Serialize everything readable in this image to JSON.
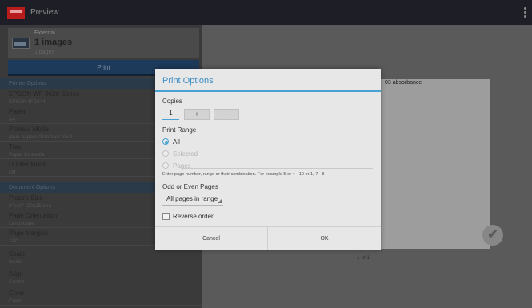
{
  "app": {
    "title": "Preview"
  },
  "source": {
    "label": "External",
    "count": "1 images",
    "pages": "1 pages"
  },
  "print_button": "Print",
  "printer_section": "Printer Options",
  "printer_settings": [
    {
      "label": "EPSON WF-3620 Series",
      "value": "EPSON4FD344"
    },
    {
      "label": "Paper",
      "value": "A4"
    },
    {
      "label": "Printout Mode",
      "value": "plain papers Standard Vivid"
    },
    {
      "label": "Tray",
      "value": "Paper Cassette"
    },
    {
      "label": "Duplex Mode",
      "value": "Off"
    }
  ],
  "document_section": "Document Options",
  "document_settings": [
    {
      "label": "Picture Size",
      "value": "8\"x10\" (20x25 cm)"
    },
    {
      "label": "Page Orientation",
      "value": "Landscape"
    },
    {
      "label": "Page Margins",
      "value": "1/4\""
    },
    {
      "label": "Scale",
      "value": "Inside"
    },
    {
      "label": "Align",
      "value": "Centre"
    },
    {
      "label": "Color",
      "value": "Color"
    }
  ],
  "preview": {
    "paper_text": "03 absorbance",
    "page_indicator": "1 of 1"
  },
  "dialog": {
    "title": "Print Options",
    "copies_label": "Copies",
    "copies_value": "1",
    "plus": "+",
    "minus": "-",
    "range_label": "Print Range",
    "range_options": [
      "All",
      "Selected",
      "Pages"
    ],
    "range_selected": "All",
    "hint": "Enter page number, range or their combination. For example 5 or 4 - 10 or 1, 7 - 8",
    "odd_even_label": "Odd or Even Pages",
    "odd_even_value": "All pages in range",
    "reverse_label": "Reverse order",
    "reverse_checked": false,
    "cancel": "Cancel",
    "ok": "OK"
  },
  "colors": {
    "accent": "#4aa1d4",
    "titlebar": "#1e1e26",
    "print_button": "#1e3a5a",
    "section_header": "#2b3a48"
  }
}
